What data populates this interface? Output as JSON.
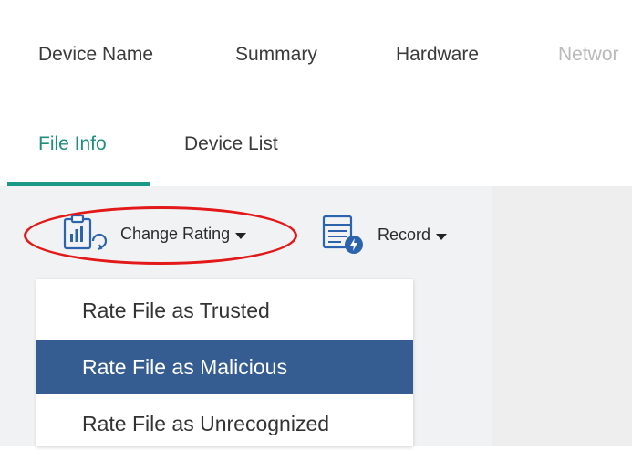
{
  "top_tabs": [
    {
      "label": "Device Name"
    },
    {
      "label": "Summary"
    },
    {
      "label": "Hardware"
    },
    {
      "label": "Networ"
    }
  ],
  "sub_tabs": [
    {
      "label": "File Info",
      "active": true
    },
    {
      "label": "Device List",
      "active": false
    }
  ],
  "toolbar": {
    "change_rating": {
      "label": "Change Rating",
      "icon": "change-rating-icon"
    },
    "record": {
      "label": "Record",
      "icon": "record-icon"
    }
  },
  "dropdown": {
    "items": [
      {
        "label": "Rate File as Trusted",
        "selected": false
      },
      {
        "label": "Rate File as Malicious",
        "selected": true
      },
      {
        "label": "Rate File as Unrecognized",
        "selected": false
      }
    ]
  },
  "colors": {
    "accent": "#1a9a86",
    "active_tab_text": "#1f8e7b",
    "selected_item_bg": "#365d91",
    "annotation_red": "#e31818",
    "icon_blue": "#1f5aa8"
  }
}
